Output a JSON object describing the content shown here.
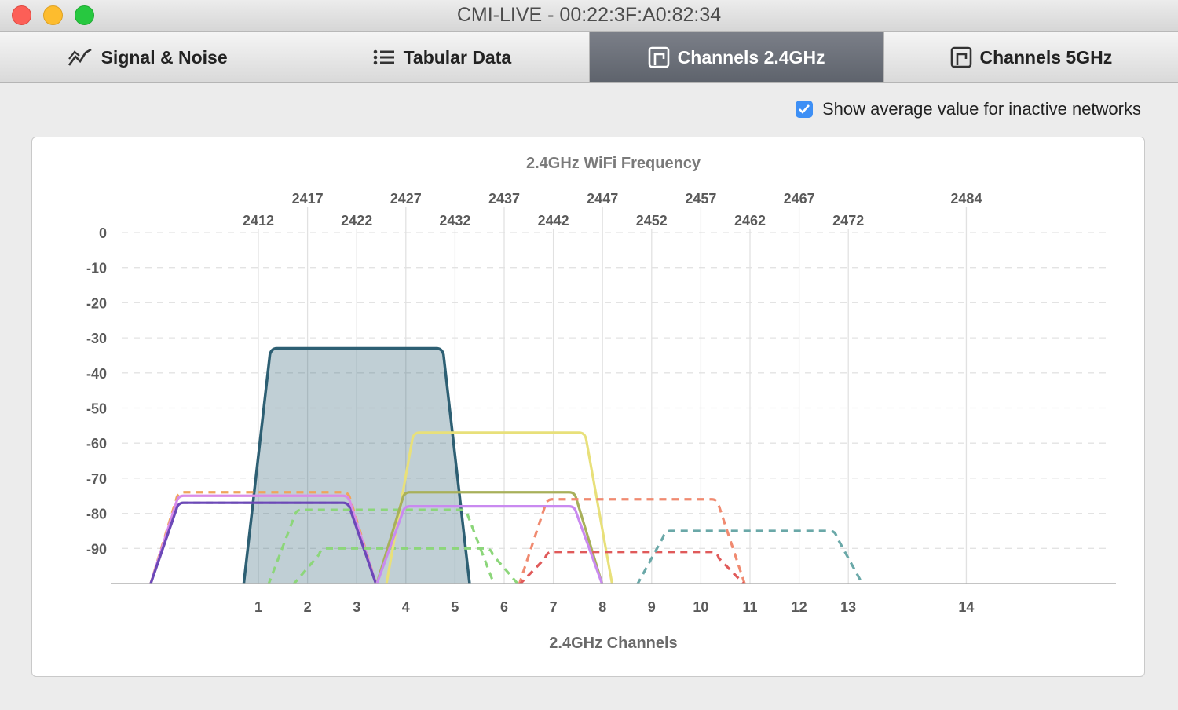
{
  "window": {
    "title": "CMI-LIVE - 00:22:3F:A0:82:34"
  },
  "tabs": [
    {
      "label": "Signal & Noise",
      "icon": "graph-icon"
    },
    {
      "label": "Tabular Data",
      "icon": "list-icon"
    },
    {
      "label": "Channels 2.4GHz",
      "icon": "channel-icon",
      "active": true
    },
    {
      "label": "Channels 5GHz",
      "icon": "channel-icon"
    }
  ],
  "option": {
    "label": "Show average value for inactive networks",
    "checked": true
  },
  "colors": {
    "accent": "#3d8ff5",
    "active_tab": "#6b6f78"
  },
  "chart_data": {
    "type": "area",
    "title": "2.4GHz WiFi Frequency",
    "xlabel": "2.4GHz Channels",
    "ylabel": "",
    "ylim": [
      -100,
      0
    ],
    "yticks": [
      0,
      -10,
      -20,
      -30,
      -40,
      -50,
      -60,
      -70,
      -80,
      -90
    ],
    "channels": [
      {
        "ch": "1",
        "freq": "2412",
        "x": 1
      },
      {
        "ch": "2",
        "freq": "2417",
        "x": 2
      },
      {
        "ch": "3",
        "freq": "2422",
        "x": 3
      },
      {
        "ch": "4",
        "freq": "2427",
        "x": 4
      },
      {
        "ch": "5",
        "freq": "2432",
        "x": 5
      },
      {
        "ch": "6",
        "freq": "2437",
        "x": 6
      },
      {
        "ch": "7",
        "freq": "2442",
        "x": 7
      },
      {
        "ch": "8",
        "freq": "2447",
        "x": 8
      },
      {
        "ch": "9",
        "freq": "2452",
        "x": 9
      },
      {
        "ch": "10",
        "freq": "2457",
        "x": 10
      },
      {
        "ch": "11",
        "freq": "2462",
        "x": 11
      },
      {
        "ch": "12",
        "freq": "2467",
        "x": 12
      },
      {
        "ch": "13",
        "freq": "2472",
        "x": 13
      },
      {
        "ch": "14",
        "freq": "2484",
        "x": 15.4
      }
    ],
    "series": [
      {
        "center": 3,
        "level": -33,
        "color": "#2d5f73",
        "style": "solid",
        "filled": true
      },
      {
        "center": 1.1,
        "level": -74,
        "color": "#f0a45c",
        "style": "dashed",
        "filled": false
      },
      {
        "center": 1.1,
        "level": -75,
        "color": "#d98be8",
        "style": "solid",
        "filled": false
      },
      {
        "center": 1.1,
        "level": -77,
        "color": "#9aa0a8",
        "style": "dashed",
        "filled": false
      },
      {
        "center": 1.1,
        "level": -77,
        "color": "#6c48b8",
        "style": "solid",
        "filled": false
      },
      {
        "center": 3.5,
        "level": -79,
        "color": "#8cd67a",
        "style": "dashed",
        "filled": false
      },
      {
        "center": 4,
        "level": -90,
        "color": "#8cd67a",
        "style": "dashed",
        "filled": false
      },
      {
        "center": 5.9,
        "level": -57,
        "color": "#e8e07a",
        "style": "solid",
        "filled": false
      },
      {
        "center": 5.7,
        "level": -74,
        "color": "#a8b05a",
        "style": "solid",
        "filled": false
      },
      {
        "center": 5.7,
        "level": -78,
        "color": "#c98af0",
        "style": "solid",
        "filled": false
      },
      {
        "center": 8.6,
        "level": -76,
        "color": "#f08a70",
        "style": "dashed",
        "filled": false
      },
      {
        "center": 8.6,
        "level": -91,
        "color": "#e05a5a",
        "style": "dashed",
        "filled": false
      },
      {
        "center": 11,
        "level": -85,
        "color": "#6aa8a8",
        "style": "dashed",
        "filled": false
      }
    ]
  }
}
